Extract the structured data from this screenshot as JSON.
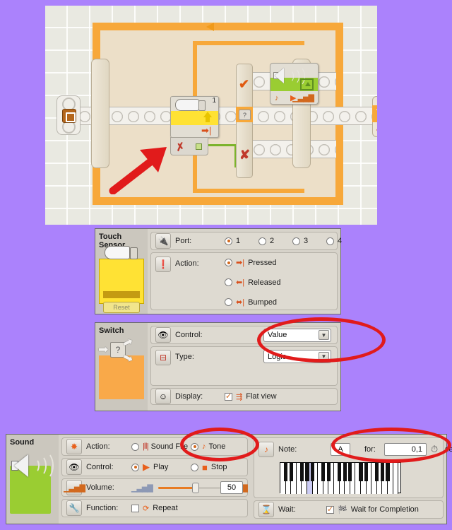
{
  "app": {
    "background_color": "#ab82fc",
    "canvas_color": "#e9e9e1"
  },
  "canvas": {
    "name": "nxt-g-program-canvas",
    "touch_sensor_block_port": "1",
    "loop_repeat": "infinite",
    "switch_true_label": "true",
    "switch_false_label": "false"
  },
  "touch_panel": {
    "title_line1": "Touch",
    "title_line2": "Sensor",
    "reset_label": "Reset",
    "port_label": "Port:",
    "port_options": [
      "1",
      "2",
      "3",
      "4"
    ],
    "port_selected": "1",
    "action_label": "Action:",
    "action_options": [
      "Pressed",
      "Released",
      "Bumped"
    ],
    "action_selected": "Pressed"
  },
  "switch_panel": {
    "title": "Switch",
    "control_label": "Control:",
    "control_value": "Value",
    "type_label": "Type:",
    "type_value": "Logic",
    "display_label": "Display:",
    "display_value": "Flat view",
    "display_checked": true,
    "highlight_color": "#e11b1b"
  },
  "sound_panel": {
    "title": "Sound",
    "action_label": "Action:",
    "action_options": [
      "Sound File",
      "Tone"
    ],
    "action_selected": "Tone",
    "control_label": "Control:",
    "control_options": [
      "Play",
      "Stop"
    ],
    "control_selected": "Play",
    "volume_label": "Volume:",
    "volume_value": "50",
    "function_label": "Function:",
    "repeat_label": "Repeat",
    "repeat_checked": false,
    "note_label": "Note:",
    "note_value": "A",
    "for_label": "for:",
    "duration_value": "0,1",
    "seconds_label": "seconds",
    "wait_label": "Wait:",
    "wait_option": "Wait for Completion",
    "wait_checked": true,
    "piano_selected_white_key_index": 5
  }
}
